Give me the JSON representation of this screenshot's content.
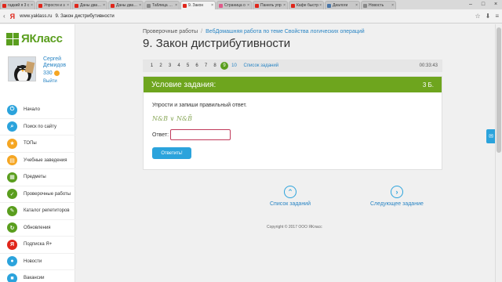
{
  "browser": {
    "tabs": [
      {
        "title": "гадкий я 3 с",
        "color": "#e0261b"
      },
      {
        "title": "Упрости и з",
        "color": "#e0261b"
      },
      {
        "title": "Даны два пр",
        "color": "#e0261b"
      },
      {
        "title": "Даны два пр",
        "color": "#e0261b"
      },
      {
        "title": "Таблица ист",
        "color": "#888888"
      },
      {
        "title": "9. Закон",
        "color": "#e0261b",
        "active": true
      },
      {
        "title": "Страница о",
        "color": "#e05a8a"
      },
      {
        "title": "Панель упр",
        "color": "#e0261b"
      },
      {
        "title": "Кафе быстр",
        "color": "#e0261b"
      },
      {
        "title": "Диалоги",
        "color": "#4a76a8"
      },
      {
        "title": "Новость",
        "color": "#888888"
      }
    ],
    "url": "www.yaklass.ru",
    "page_title": "9. Закон дистрибутивности",
    "logo_glyph": "Я"
  },
  "site": {
    "logo": "ЯКласс"
  },
  "user": {
    "name_line1": "Сергей",
    "name_line2": "Демидов",
    "points": "330",
    "logout": "Выйти"
  },
  "menu": [
    {
      "label": "Начало",
      "icon": "power-icon",
      "glyph": "⏻",
      "color": "#2ba3dc"
    },
    {
      "label": "Поиск по сайту",
      "icon": "search-icon",
      "glyph": "⌕",
      "color": "#2ba3dc"
    },
    {
      "label": "ТОПы",
      "icon": "star-icon",
      "glyph": "★",
      "color": "#f5a623"
    },
    {
      "label": "Учебные заведения",
      "icon": "school-icon",
      "glyph": "▤",
      "color": "#f5a623"
    },
    {
      "label": "Предметы",
      "icon": "book-icon",
      "glyph": "▦",
      "color": "#5a9e1e"
    },
    {
      "label": "Проверочные работы",
      "icon": "check-icon",
      "glyph": "✓",
      "color": "#5a9e1e"
    },
    {
      "label": "Каталог репетиторов",
      "icon": "tutor-icon",
      "glyph": "✎",
      "color": "#5a9e1e"
    },
    {
      "label": "Обновления",
      "icon": "refresh-icon",
      "glyph": "↻",
      "color": "#5a9e1e"
    },
    {
      "label": "Подписка Я+",
      "icon": "subscription-icon",
      "glyph": "Я",
      "color": "#e0261b"
    },
    {
      "label": "Новости",
      "icon": "chat-icon",
      "glyph": "●",
      "color": "#2ba3dc"
    },
    {
      "label": "Вакансии",
      "icon": "briefcase-icon",
      "glyph": "■",
      "color": "#2ba3dc"
    }
  ],
  "breadcrumb": {
    "root": "Проверочные работы",
    "sep": "/",
    "current": "ВебДомашняя работа по теме Свойства логических операций"
  },
  "title": "9. Закон дистрибутивности",
  "pager": {
    "pages": [
      "1",
      "2",
      "3",
      "4",
      "5",
      "6",
      "7",
      "8",
      "9",
      "10"
    ],
    "current": "9",
    "list_link": "Список заданий",
    "timer": "00:33:43"
  },
  "task": {
    "header": "Условие задания:",
    "points": "3 Б.",
    "text": "Упрости и запиши правильный ответ.",
    "formula": "N&B ∨ N&B̄",
    "answer_label": "Ответ:",
    "answer_value": "",
    "submit": "Ответить!"
  },
  "nav": {
    "list_label": "Список заданий",
    "list_glyph": "⌃",
    "next_label": "Следующее задание",
    "next_glyph": "›"
  },
  "footer": {
    "copyright": "Copyright © 2017 ООО ЯКласс"
  },
  "float": {
    "glyph": "✉"
  }
}
